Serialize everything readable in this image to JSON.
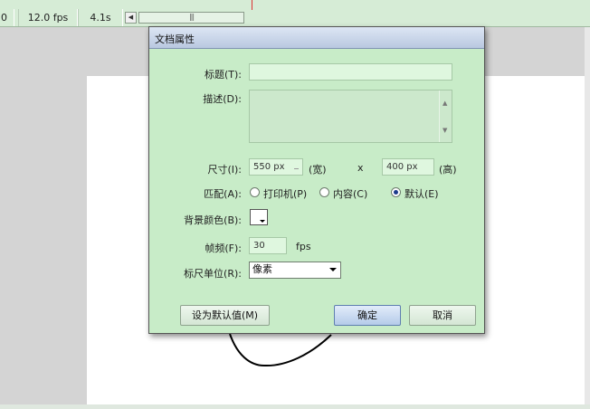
{
  "timeline": {
    "frame": "0",
    "fps": "12.0 fps",
    "time": "4.1s",
    "scroll_left_glyph": "◀",
    "scroll_thumb_grip": "|||"
  },
  "dialog": {
    "title": "文档属性",
    "title_field": {
      "label": "标题(T):",
      "value": ""
    },
    "description": {
      "label": "描述(D):",
      "value": "",
      "scroll_up": "▲",
      "scroll_down": "▼"
    },
    "size": {
      "label": "尺寸(I):",
      "width": "550 px",
      "width_unit": "(宽)",
      "separator": "x",
      "height": "400 px",
      "height_unit": "(高)"
    },
    "match": {
      "label": "匹配(A):",
      "options": [
        {
          "label": "打印机(P)",
          "checked": false
        },
        {
          "label": "内容(C)",
          "checked": false
        },
        {
          "label": "默认(E)",
          "checked": true
        }
      ]
    },
    "background_color": {
      "label": "背景颜色(B):",
      "color": "#ffffff"
    },
    "frame_rate": {
      "label": "帧频(F):",
      "value": "30",
      "unit": "fps"
    },
    "ruler_units": {
      "label": "标尺单位(R):",
      "value": "像素"
    },
    "buttons": {
      "make_default": "设为默认值(M)",
      "ok": "确定",
      "cancel": "取消"
    }
  }
}
